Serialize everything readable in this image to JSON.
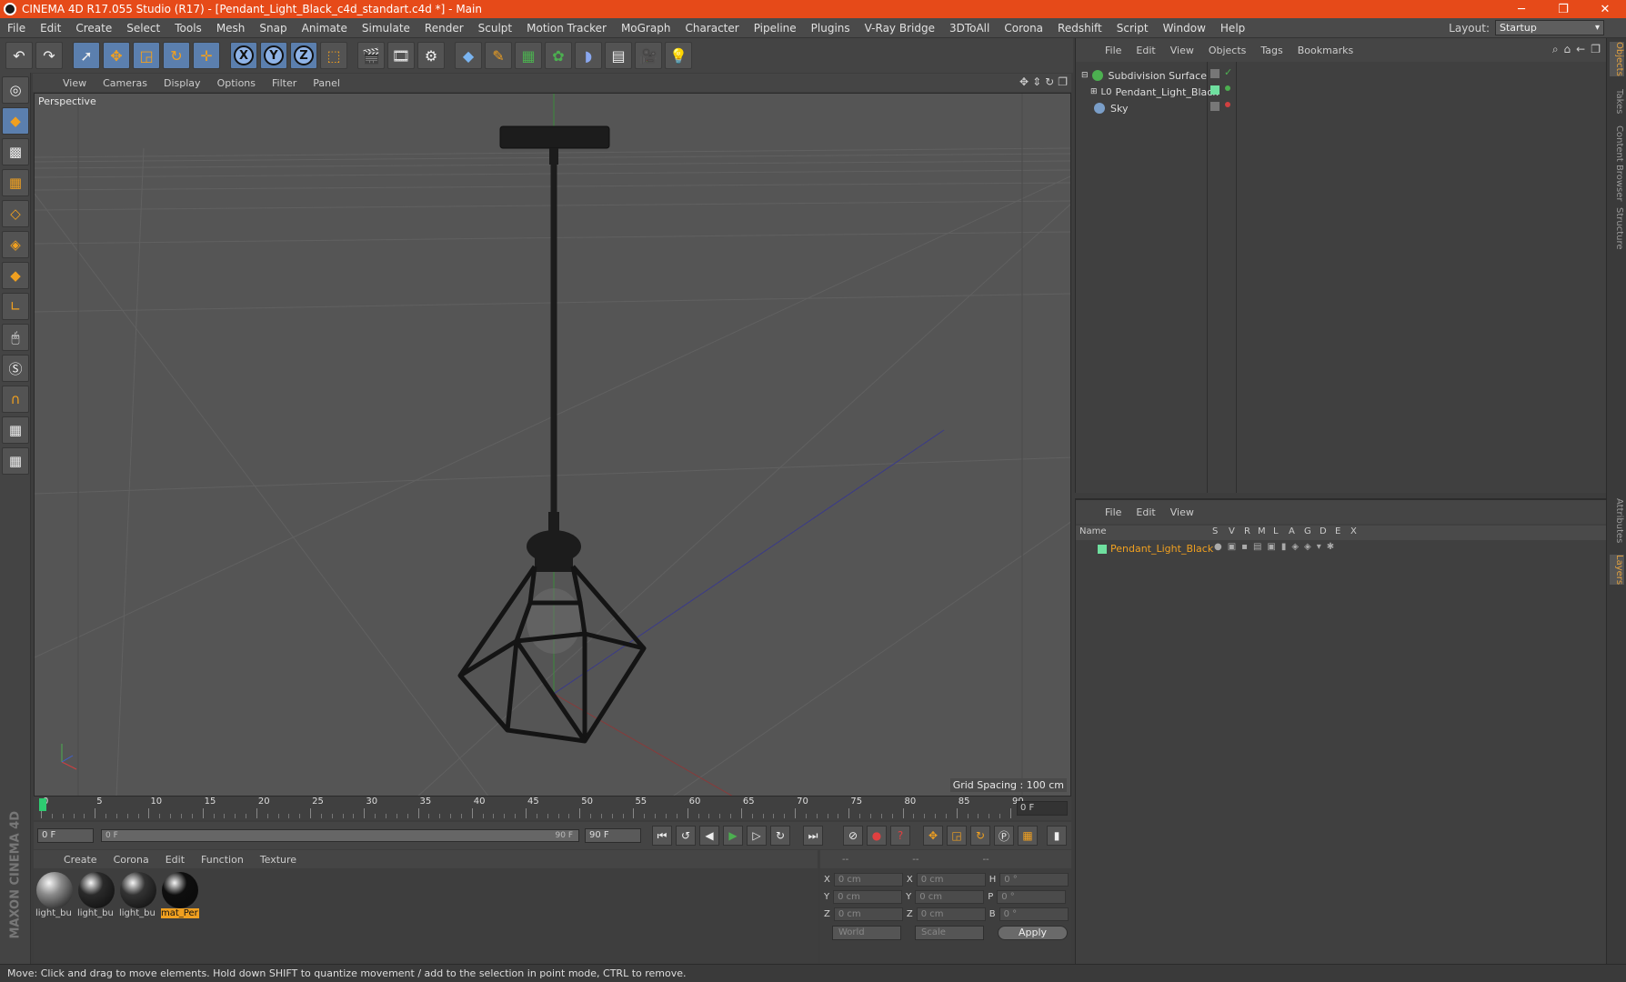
{
  "window": {
    "title": "CINEMA 4D R17.055 Studio (R17) - [Pendant_Light_Black_c4d_standart.c4d *] - Main",
    "minimize": "─",
    "restore": "❐",
    "close": "✕"
  },
  "menubar": [
    "File",
    "Edit",
    "Create",
    "Select",
    "Tools",
    "Mesh",
    "Snap",
    "Animate",
    "Simulate",
    "Render",
    "Sculpt",
    "Motion Tracker",
    "MoGraph",
    "Character",
    "Pipeline",
    "Plugins",
    "V-Ray Bridge",
    "3DToAll",
    "Corona",
    "Redshift",
    "Script",
    "Window",
    "Help"
  ],
  "layout": {
    "label": "Layout:",
    "value": "Startup"
  },
  "toolbar": {
    "undo": "↶",
    "redo": "↷",
    "axis_x": "X",
    "axis_y": "Y",
    "axis_z": "Z"
  },
  "viewport": {
    "menu": [
      "View",
      "Cameras",
      "Display",
      "Options",
      "Filter",
      "Panel"
    ],
    "label": "Perspective",
    "grid_spacing": "Grid Spacing : 100 cm"
  },
  "timeline": {
    "ticks": [
      "0",
      "5",
      "10",
      "15",
      "20",
      "25",
      "30",
      "35",
      "40",
      "45",
      "50",
      "55",
      "60",
      "65",
      "70",
      "75",
      "80",
      "85",
      "90"
    ],
    "current_frame": "0 F",
    "start_field": "0 F",
    "slider_start": "0 F",
    "slider_end": "90 F",
    "end_field": "90 F"
  },
  "materials": {
    "menu": [
      "Create",
      "Corona",
      "Edit",
      "Function",
      "Texture"
    ],
    "items": [
      {
        "label": "light_bu",
        "color": "#8a8a8a"
      },
      {
        "label": "light_bu",
        "color": "#2a2a2a"
      },
      {
        "label": "light_bu",
        "color": "#333333"
      },
      {
        "label": "mat_Per",
        "color": "#0e0e0e"
      }
    ]
  },
  "coords": {
    "head": [
      "--",
      "--",
      "--"
    ],
    "rows": [
      {
        "a": "X",
        "a_val": "0 cm",
        "b": "X",
        "b_val": "0 cm",
        "c": "H",
        "c_val": "0 °"
      },
      {
        "a": "Y",
        "a_val": "0 cm",
        "b": "Y",
        "b_val": "0 cm",
        "c": "P",
        "c_val": "0 °"
      },
      {
        "a": "Z",
        "a_val": "0 cm",
        "b": "Z",
        "b_val": "0 cm",
        "c": "B",
        "c_val": "0 °"
      }
    ],
    "world": "World",
    "scale": "Scale",
    "apply": "Apply"
  },
  "objects": {
    "menu": [
      "File",
      "Edit",
      "View",
      "Objects",
      "Tags",
      "Bookmarks"
    ],
    "items": [
      {
        "name": "Subdivision Surface",
        "color": "#4caf50"
      },
      {
        "name": "Pendant_Light_Black",
        "color": "#cccccc"
      },
      {
        "name": "Sky",
        "color": "#7a9ec8"
      }
    ]
  },
  "layers": {
    "menu": [
      "File",
      "Edit",
      "View"
    ],
    "columns": [
      "Name",
      "S",
      "V",
      "R",
      "M",
      "L",
      "A",
      "G",
      "D",
      "E",
      "X"
    ],
    "row": "Pendant_Light_Black"
  },
  "sidetabs": [
    "Objects",
    "Takes",
    "Content Browser",
    "Structure",
    "Attributes",
    "Layers"
  ],
  "brand": "MAXON CINEMA 4D",
  "status": "Move: Click and drag to move elements. Hold down SHIFT to quantize movement / add to the selection in point mode, CTRL to remove."
}
